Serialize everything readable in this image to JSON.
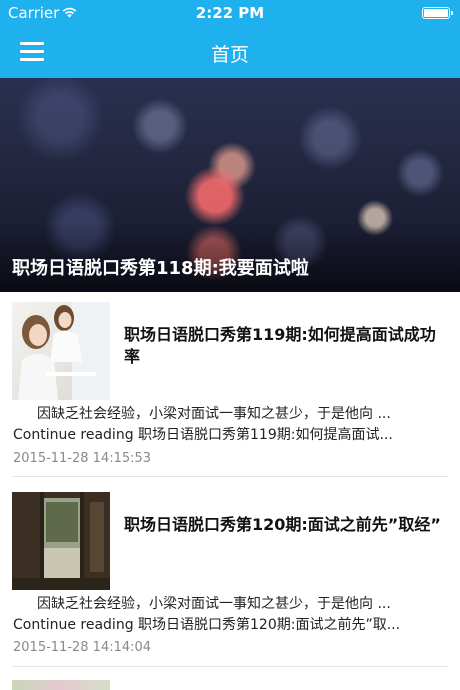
{
  "status_bar": {
    "carrier": "Carrier",
    "time": "2:22 PM"
  },
  "nav": {
    "title": "首页"
  },
  "hero": {
    "title": "职场日语脱口秀第118期:我要面试啦"
  },
  "articles": [
    {
      "title": "职场日语脱口秀第119期:如何提高面试成功率",
      "excerpt": "因缺乏社会经验，小梁对面试一事知之甚少，于是他向 ...",
      "continue": "Continue reading 职场日语脱口秀第119期:如何提高面试...",
      "date": "2015-11-28 14:15:53"
    },
    {
      "title": "职场日语脱口秀第120期:面试之前先”取经”",
      "excerpt": "因缺乏社会经验，小梁对面试一事知之甚少，于是他向 ...",
      "continue": "Continue reading 职场日语脱口秀第120期:面试之前先”取...",
      "date": "2015-11-28 14:14:04"
    }
  ]
}
